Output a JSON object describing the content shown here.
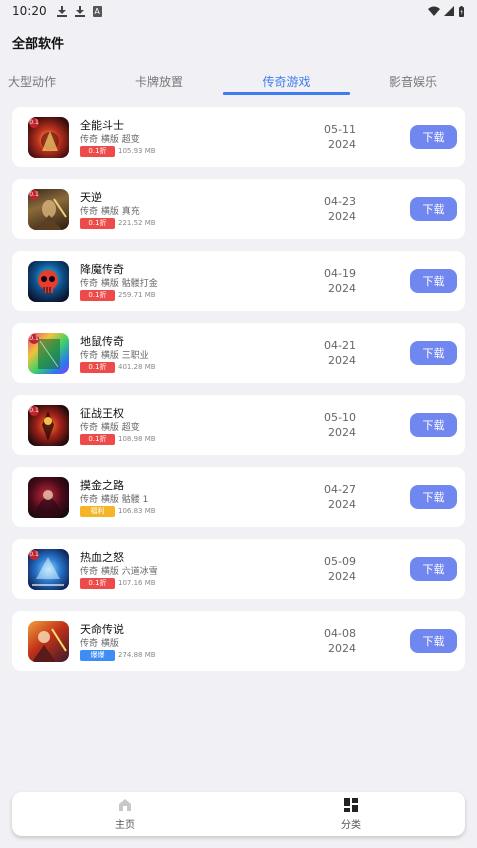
{
  "status_bar": {
    "time": "10:20",
    "a_icon": "A"
  },
  "header": {
    "title": "全部软件"
  },
  "tabs": [
    {
      "label": "大型动作",
      "active": false
    },
    {
      "label": "卡牌放置",
      "active": false
    },
    {
      "label": "传奇游戏",
      "active": true
    },
    {
      "label": "影音娱乐",
      "active": false
    }
  ],
  "accent_color": "#3f7cf0",
  "button_color": "#7187f0",
  "apps": [
    {
      "name": "全能斗士",
      "tags": "传奇 横版 超变",
      "badge": "0.1折",
      "badge_color": "red",
      "size": "105.93 MB",
      "date_md": "05-11",
      "date_y": "2024",
      "button": "下载",
      "icon": "fighter-game-icon"
    },
    {
      "name": "天逆",
      "tags": "传奇 横版 真充",
      "badge": "0.1折",
      "badge_color": "red",
      "size": "221.52 MB",
      "date_md": "04-23",
      "date_y": "2024",
      "button": "下载",
      "icon": "tianni-game-icon"
    },
    {
      "name": "降魔传奇",
      "tags": "传奇 横版 骷髅打金",
      "badge": "0.1折",
      "badge_color": "red",
      "size": "259.71 MB",
      "date_md": "04-19",
      "date_y": "2024",
      "button": "下载",
      "icon": "skull-game-icon"
    },
    {
      "name": "地鼠传奇",
      "tags": "传奇 横版 三职业",
      "badge": "0.1折",
      "badge_color": "red",
      "size": "401.28 MB",
      "date_md": "04-21",
      "date_y": "2024",
      "button": "下载",
      "icon": "gopher-game-icon"
    },
    {
      "name": "征战王权",
      "tags": "传奇 横版 超变",
      "badge": "0.1折",
      "badge_color": "red",
      "size": "108.98 MB",
      "date_md": "05-10",
      "date_y": "2024",
      "button": "下载",
      "icon": "kingship-game-icon"
    },
    {
      "name": "摸金之路",
      "tags": "传奇 横版 骷髅 1",
      "badge": "福利",
      "badge_color": "yellow",
      "size": "106.83 MB",
      "date_md": "04-27",
      "date_y": "2024",
      "button": "下载",
      "icon": "gold-road-game-icon"
    },
    {
      "name": "热血之怒",
      "tags": "传奇 横版 六道冰雪",
      "badge": "0.1折",
      "badge_color": "red",
      "size": "107.16 MB",
      "date_md": "05-09",
      "date_y": "2024",
      "button": "下载",
      "icon": "rage-game-icon"
    },
    {
      "name": "天命传说",
      "tags": "传奇 横版",
      "badge": "爆爆",
      "badge_color": "blue",
      "size": "274.88 MB",
      "date_md": "04-08",
      "date_y": "2024",
      "button": "下载",
      "icon": "destiny-game-icon"
    }
  ],
  "bottom_nav": [
    {
      "label": "主页",
      "icon": "home-icon"
    },
    {
      "label": "分类",
      "icon": "category-icon"
    }
  ]
}
